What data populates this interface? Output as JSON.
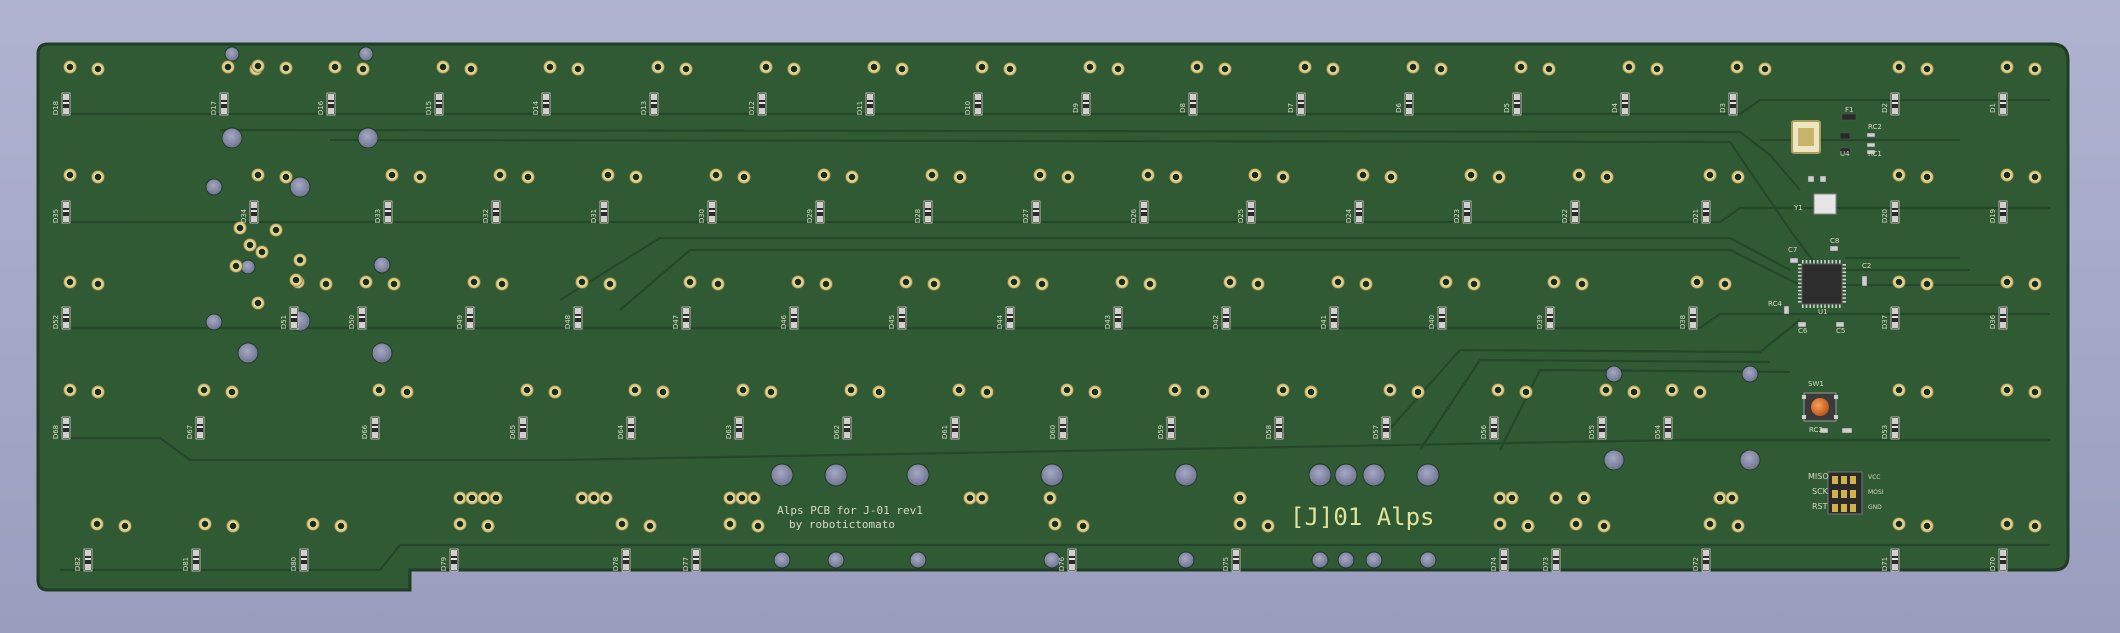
{
  "viewer": {
    "background": "#a7aac8"
  },
  "board": {
    "pcb_color": "#2f5a33",
    "trace_color": "#23452a",
    "edge_color": "#1f3d24",
    "pad_ring_color": "#e6d99a",
    "silk_color": "#d9d9c8"
  },
  "silkscreen": {
    "credit_line1": "Alps PCB for J-01 rev1",
    "credit_line2": "by robotictomato",
    "logo": "[J]01 Alps",
    "logo_color": "#e4e29a"
  },
  "components": {
    "fuse": "F1",
    "regulator": "U4",
    "rc2": "RC2",
    "rc1": "RC1",
    "crystal": "Y1",
    "mcu": "U1",
    "cap_c7": "C7",
    "cap_c8": "C8",
    "cap_c2": "C2",
    "cap_c6": "C6",
    "cap_c5": "C5",
    "rc4": "RC4",
    "reset_switch": "SW1",
    "rc3": "RC3",
    "isp_labels": [
      "MISO",
      "SCK",
      "RST"
    ],
    "isp_labels_right": [
      "VCC",
      "MOSI",
      "GND"
    ]
  },
  "diodes": {
    "row1": [
      "D1",
      "D2",
      "D3",
      "D4",
      "D5",
      "D6",
      "D7",
      "D8",
      "D9",
      "D10",
      "D11",
      "D12",
      "D13",
      "D14",
      "D15",
      "D16",
      "D17",
      "D18"
    ],
    "row2": [
      "D19",
      "D20",
      "D21",
      "D22",
      "D23",
      "D24",
      "D25",
      "D26",
      "D27",
      "D28",
      "D29",
      "D30",
      "D31",
      "D32",
      "D33",
      "D34",
      "D35"
    ],
    "row3": [
      "D36",
      "D37",
      "D38",
      "D39",
      "D40",
      "D41",
      "D42",
      "D43",
      "D44",
      "D45",
      "D46",
      "D47",
      "D48",
      "D49",
      "D50",
      "D51",
      "D52"
    ],
    "row4": [
      "D53",
      "D54",
      "D55",
      "D56",
      "D57",
      "D58",
      "D59",
      "D60",
      "D61",
      "D62",
      "D63",
      "D64",
      "D65",
      "D66",
      "D67",
      "D68"
    ],
    "row5": [
      "D69",
      "D70",
      "D71",
      "D72",
      "D73",
      "D74",
      "D75",
      "D76",
      "D77",
      "D78",
      "D79",
      "D80",
      "D81",
      "D82"
    ]
  }
}
